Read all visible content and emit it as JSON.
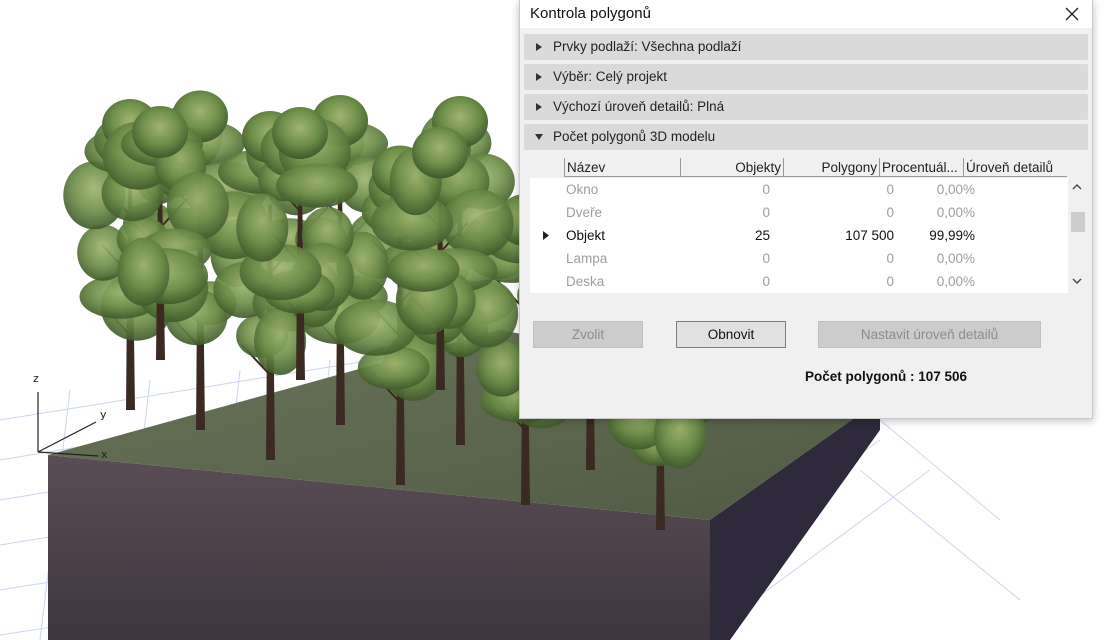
{
  "viewport": {
    "axis_labels": {
      "x": "x",
      "y": "y",
      "z": "z"
    }
  },
  "dialog": {
    "title": "Kontrola polygonů",
    "sections": [
      {
        "label": "Prvky podlaží: Všechna podlaží",
        "expanded": false
      },
      {
        "label": "Výběr: Celý projekt",
        "expanded": false
      },
      {
        "label": "Výchozí úroveň detailů: Plná",
        "expanded": false
      },
      {
        "label": "Počet polygonů 3D modelu",
        "expanded": true
      }
    ],
    "table": {
      "headers": {
        "name": "Název",
        "objects": "Objekty",
        "polygons": "Polygony",
        "percent": "Procentuál...",
        "detail": "Úroveň detailů"
      },
      "rows": [
        {
          "name": "Okno",
          "objects": "0",
          "polygons": "0",
          "percent": "0,00%",
          "detail": "",
          "dim": true
        },
        {
          "name": "Dveře",
          "objects": "0",
          "polygons": "0",
          "percent": "0,00%",
          "detail": "",
          "dim": true
        },
        {
          "name": "Objekt",
          "objects": "25",
          "polygons": "107 500",
          "percent": "99,99%",
          "detail": "",
          "dim": false
        },
        {
          "name": "Lampa",
          "objects": "0",
          "polygons": "0",
          "percent": "0,00%",
          "detail": "",
          "dim": true
        },
        {
          "name": "Deska",
          "objects": "0",
          "polygons": "0",
          "percent": "0,00%",
          "detail": "",
          "dim": true
        }
      ]
    },
    "buttons": {
      "select": "Zvolit",
      "refresh": "Obnovit",
      "set_detail": "Nastavit úroveň detailů"
    },
    "total": "Počet polygonů : 107 506"
  },
  "colors": {
    "foliage": "#6e8f4a",
    "foliage_dark": "#3f5a2b",
    "trunk": "#3b2a22",
    "ground_top": "#5d6a4c",
    "ground_side": "#4a3f48",
    "grid_line": "#c9d6ee"
  }
}
